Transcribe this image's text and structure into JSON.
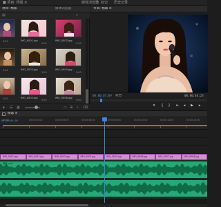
{
  "menubar": {
    "items": [
      {
        "label": "■ 项目: 杨幂 ≡"
      },
      {
        "label": "媒体浏览器"
      },
      {
        "label": "标记"
      },
      {
        "label": "历史记录"
      }
    ]
  },
  "project": {
    "tabs": [
      {
        "label": "项目: 杨幂"
      },
      {
        "label": "媒体浏览器"
      }
    ],
    "search_placeholder": "",
    "clips": [
      {
        "name": "",
        "duration": "3:52"
      },
      {
        "name": "IMG_0001.jpg",
        "duration": "5:00"
      },
      {
        "name": "IMG_0002.jpg",
        "duration": "5:00"
      },
      {
        "name": "",
        "duration": "3:00"
      },
      {
        "name": "IMG_0003.jpg",
        "duration": "5:00"
      },
      {
        "name": "IMG_0004.jpg",
        "duration": "5:00"
      },
      {
        "name": "",
        "duration": "5:00"
      },
      {
        "name": "IMG_0005.jpg",
        "duration": "5:00"
      },
      {
        "name": "IMG_0006.jpg",
        "duration": "5:00"
      }
    ]
  },
  "program": {
    "title": "节目: 杨幂 ≡",
    "current_timecode": "00;00;05;09",
    "fit_label": "适合",
    "duration_timecode": "00;00;46;23"
  },
  "timeline": {
    "title": "杨幂 ≡",
    "timecode": "00;00;05;09",
    "ruler_labels": [
      "00;00",
      "00;00;02;00",
      "00;00;04;00",
      "00;00;06;00",
      "00;00;08;00",
      "00;00;10;00",
      "00;00;12;00",
      "00;00;14;00"
    ],
    "video_clips": [
      {
        "label": "IMG_0001.jpg"
      },
      {
        "label": "IMG_0002.jpg"
      },
      {
        "label": "IMG_0003.jpg"
      },
      {
        "label": "IMG_0004.jpg"
      },
      {
        "label": "IMG_0005.jpg"
      },
      {
        "label": "IMG_0006.jpg"
      },
      {
        "label": "IMG_0007.jpg"
      },
      {
        "label": "IMG_0008.jpg"
      }
    ],
    "audio_label": "杨幂.mp3"
  },
  "colors": {
    "accent": "#3a85dd",
    "video_clip": "#d88bd9",
    "audio_clip": "#25a87a"
  }
}
